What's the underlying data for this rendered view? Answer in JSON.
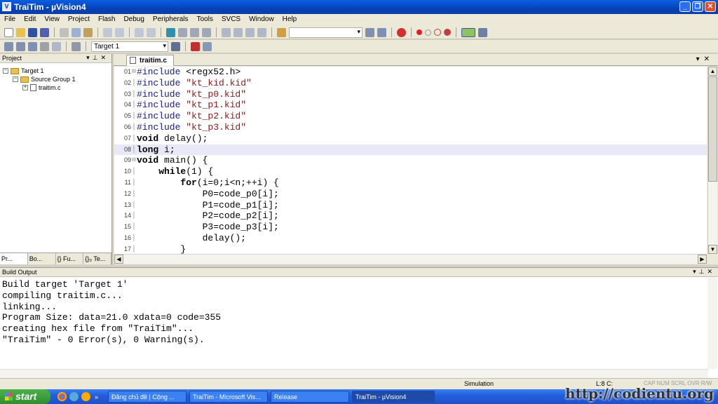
{
  "window": {
    "title": "TraiTim  - µVision4",
    "app_icon": "V"
  },
  "menu": [
    "File",
    "Edit",
    "View",
    "Project",
    "Flash",
    "Debug",
    "Peripherals",
    "Tools",
    "SVCS",
    "Window",
    "Help"
  ],
  "toolbar2": {
    "target_select": "Target 1"
  },
  "project_panel": {
    "title": "Project",
    "tree": {
      "target": "Target 1",
      "group": "Source Group 1",
      "file": "traitim.c"
    },
    "tabs": [
      "Pr...",
      "Bo...",
      "{} Fu...",
      "{}₀ Te..."
    ]
  },
  "editor": {
    "tab": "traitim.c",
    "lines": [
      {
        "n": "01",
        "parts": [
          [
            "pp",
            "#include "
          ],
          [
            "",
            "<regx52.h>"
          ]
        ]
      },
      {
        "n": "02",
        "parts": [
          [
            "pp",
            "#include "
          ],
          [
            "st",
            "\"kt_kid.kid\""
          ]
        ]
      },
      {
        "n": "03",
        "parts": [
          [
            "pp",
            "#include "
          ],
          [
            "st",
            "\"kt_p0.kid\""
          ]
        ]
      },
      {
        "n": "04",
        "parts": [
          [
            "pp",
            "#include "
          ],
          [
            "st",
            "\"kt_p1.kid\""
          ]
        ]
      },
      {
        "n": "05",
        "parts": [
          [
            "pp",
            "#include "
          ],
          [
            "st",
            "\"kt_p2.kid\""
          ]
        ]
      },
      {
        "n": "06",
        "parts": [
          [
            "pp",
            "#include "
          ],
          [
            "st",
            "\"kt_p3.kid\""
          ]
        ]
      },
      {
        "n": "07",
        "parts": [
          [
            "kw",
            "void"
          ],
          [
            "",
            " delay();"
          ]
        ]
      },
      {
        "n": "08",
        "parts": [
          [
            "kw",
            "long"
          ],
          [
            "",
            " i;"
          ]
        ]
      },
      {
        "n": "09",
        "parts": [
          [
            "kw",
            "void"
          ],
          [
            "",
            " main() {"
          ]
        ]
      },
      {
        "n": "10",
        "parts": [
          [
            "",
            "    "
          ],
          [
            "kw",
            "while"
          ],
          [
            "",
            "(1) {"
          ]
        ]
      },
      {
        "n": "11",
        "parts": [
          [
            "",
            "        "
          ],
          [
            "kw",
            "for"
          ],
          [
            "",
            "(i=0;i<n;++i) {"
          ]
        ]
      },
      {
        "n": "12",
        "parts": [
          [
            "",
            "            P0=code_p0[i];"
          ]
        ]
      },
      {
        "n": "13",
        "parts": [
          [
            "",
            "            P1=code_p1[i];"
          ]
        ]
      },
      {
        "n": "14",
        "parts": [
          [
            "",
            "            P2=code_p2[i];"
          ]
        ]
      },
      {
        "n": "15",
        "parts": [
          [
            "",
            "            P3=code_p3[i];"
          ]
        ]
      },
      {
        "n": "16",
        "parts": [
          [
            "",
            "            delay();"
          ]
        ]
      },
      {
        "n": "17",
        "parts": [
          [
            "",
            "        }"
          ]
        ]
      }
    ],
    "current_line": "08"
  },
  "build_output": {
    "title": "Build Output",
    "lines": [
      "Build target 'Target 1'",
      "compiling traitim.c...",
      "linking...",
      "Program Size: data=21.0 xdata=0 code=355",
      "creating hex file from \"TraiTim\"...",
      "\"TraiTim\" - 0 Error(s), 0 Warning(s)."
    ]
  },
  "status": {
    "mode": "Simulation",
    "position": "L:8 C:",
    "indicators": "CAP  NUM  SCRL  OVR  R/W"
  },
  "taskbar": {
    "start": "start",
    "tasks": [
      "Đăng chủ đề | Cộng ...",
      "TraiTim - Microsoft Vis...",
      "Release",
      "TraiTim  - µVision4"
    ],
    "active_task": 3
  },
  "watermark": "http://codientu.org"
}
